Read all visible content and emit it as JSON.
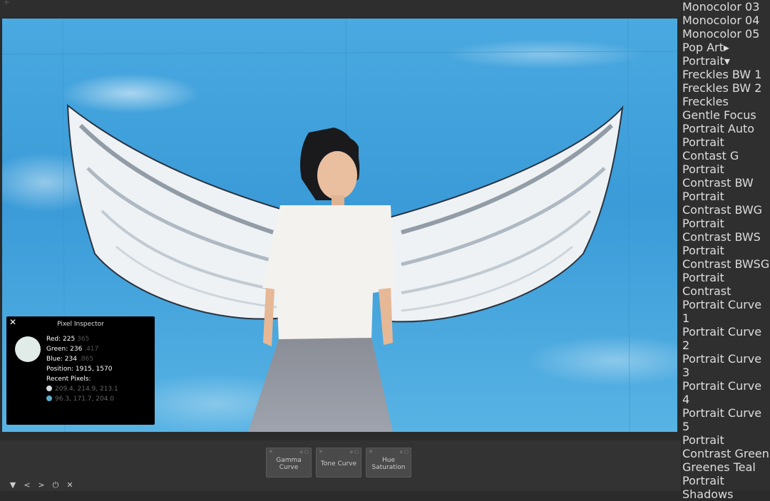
{
  "sidebar": {
    "items_top": [
      "Monocolor 03",
      "Monocolor 04",
      "Monocolor 05"
    ],
    "group_pop_art": {
      "label": "Pop Art",
      "arrow": "▸"
    },
    "group_portrait": {
      "label": "Portrait",
      "arrow": "▾"
    },
    "portrait_items": [
      "Freckles BW 1",
      "Freckles BW 2",
      "Freckles",
      "Gentle Focus",
      "Portrait Auto",
      "Portrait Contast G",
      "Portrait Contrast BW",
      "Portrait Contrast BWG",
      "Portrait Contrast BWS",
      "Portrait Contrast BWSG",
      "Portrait Contrast",
      "Portrait Curve 1",
      "Portrait Curve 2",
      "Portrait Curve 3",
      "Portrait Curve 4",
      "Portrait Curve 5",
      "Portrait Contrast Green",
      "Greenes Teal",
      "Portrait Shadows"
    ]
  },
  "inspector": {
    "title": "Pixel Inspector",
    "close": "✕",
    "swatch_color": "#e1ece9",
    "red_label": "Red: 225",
    "red_extra": "365",
    "green_label": "Green: 236",
    "green_extra": ".417",
    "blue_label": "Blue: 234",
    "blue_extra": ".865",
    "position": "Position: 1915, 1570",
    "recent_label": "Recent Pixels:",
    "recent": [
      {
        "color": "#d6dbdf",
        "value": "209.4, 214.9, 213.1"
      },
      {
        "color": "#60abcc",
        "value": "96.3, 171.7, 204.0"
      }
    ]
  },
  "tools": [
    {
      "label1": "Gamma",
      "label2": "Curve"
    },
    {
      "label1": "Tone Curve",
      "label2": ""
    },
    {
      "label1": "Hue",
      "label2": "Saturation"
    }
  ],
  "nav": [
    "▼",
    "<",
    ">",
    "⏻",
    "✕"
  ]
}
